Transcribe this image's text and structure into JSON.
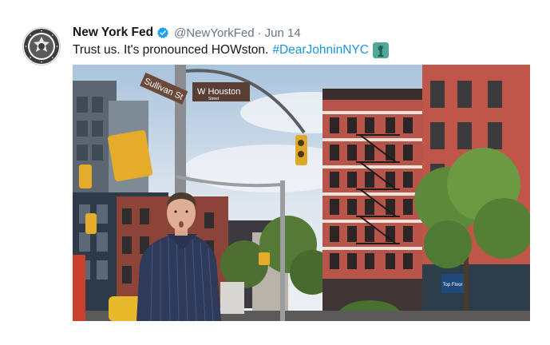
{
  "tweet": {
    "display_name": "New York Fed",
    "handle": "@NewYorkFed",
    "separator": "·",
    "date": "Jun 14",
    "text": "Trust us. It's pronounced HOWston.",
    "hashtag": "#DearJohninNYC",
    "hashtag_emoji": "statue-of-liberty-icon",
    "verified_badge": "verified-icon",
    "avatar": "federal-reserve-seal-logo"
  },
  "photo": {
    "street_sign_1": "Sullivan St",
    "street_sign_2": "W Houston",
    "street_sign_2_sub": "Street",
    "shop_sign": "Top Floor"
  },
  "colors": {
    "link": "#1b95e0",
    "verified": "#1da1f2",
    "muted": "#657786",
    "text": "#14171a"
  }
}
